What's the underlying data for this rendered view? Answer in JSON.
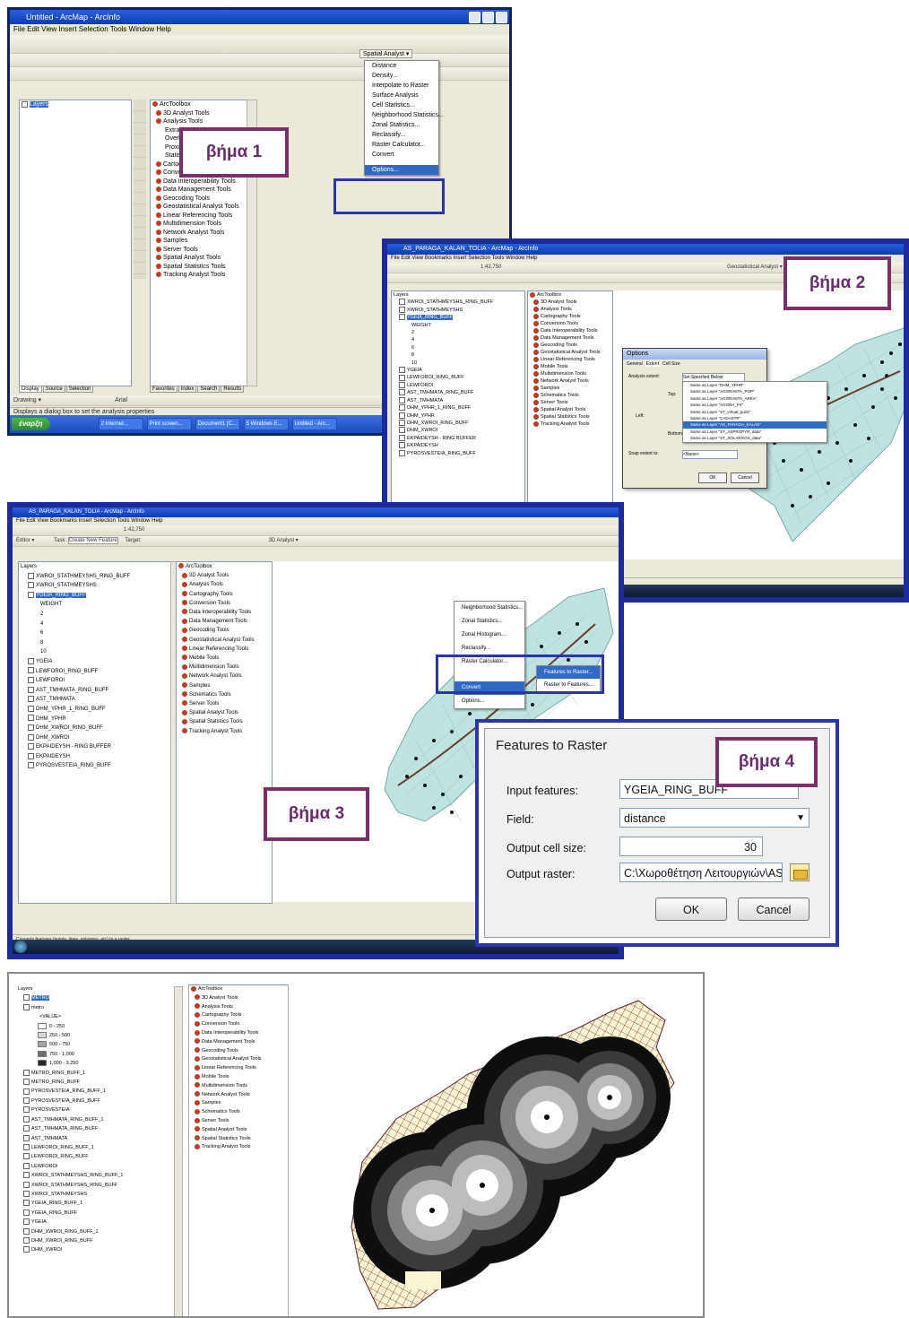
{
  "steps": {
    "s1": "βήμα 1",
    "s2": "βήμα 2",
    "s3": "βήμα 3",
    "s4": "βήμα 4"
  },
  "shot1": {
    "title": "Untitled - ArcMap - ArcInfo",
    "menu": "File  Edit  View  Insert  Selection  Tools  Window  Help",
    "layers_root": "Layers",
    "toolbox_root": "ArcToolbox",
    "toolbox": [
      "3D Analyst Tools",
      "Analysis Tools",
      "Extract",
      "Overlay",
      "Proximity",
      "Statistics",
      "Cartography Tools",
      "Conversion Tools",
      "Data Interoperability Tools",
      "Data Management Tools",
      "Geocoding Tools",
      "Geostatistical Analyst Tools",
      "Linear Referencing Tools",
      "Multidimension Tools",
      "Network Analyst Tools",
      "Samples",
      "Server Tools",
      "Spatial Analyst Tools",
      "Spatial Statistics Tools",
      "Tracking Analyst Tools"
    ],
    "spatial_analyst_menu": {
      "button": "Spatial Analyst ▾",
      "items": [
        "Distance",
        "Density...",
        "Interpolate to Raster",
        "Surface Analysis",
        "Cell Statistics...",
        "Neighborhood Statistics...",
        "Zonal Statistics...",
        "Reclassify...",
        "Raster Calculator...",
        "Convert",
        "Options..."
      ],
      "highlighted": "Options..."
    },
    "tabs": [
      "Display",
      "Source",
      "Selection"
    ],
    "toolbox_tabs": [
      "Favorites",
      "Index",
      "Search",
      "Results"
    ],
    "drawing": "Drawing ▾",
    "font": "Arial",
    "status": "Displays a dialog box to set the analysis properties",
    "start": "έναρξη",
    "taskbar": [
      "2 Internet...",
      "Print screen...",
      "Document1 [C...",
      "5 Windows E...",
      "Untitled - Arc..."
    ]
  },
  "shot2": {
    "title": "AS_PARAGA_KALAN_TOLIA - ArcMap - ArcInfo",
    "menu": "File  Edit  View  Bookmarks  Insert  Selection  Tools  Window  Help",
    "scale": "1:42,750",
    "geostat": "Geostatistical Analyst ▾",
    "layers_root": "Layers",
    "layers": [
      "XWROI_STATHMEYSHS_RING_BUFF",
      "XWROI_STATHMEYSHS",
      "YGEIA_RING_BUFF",
      "WEIGHT",
      "2",
      "4",
      "6",
      "8",
      "10",
      "YGEIA",
      "LEWFOROI_RING_BUFF",
      "LEWFOROI",
      "AST_TMHMATA_RING_BUFF",
      "AST_TMHMATA",
      "DHM_YPHR_1_RING_BUFF",
      "DHM_YPHR",
      "DHM_XWROI_RING_BUFF",
      "DHM_XWROI",
      "EKPAIDEYSH - RING BUFFER",
      "EKPAIDEYSH",
      "PYROSVESTEIA_RING_BUFF"
    ],
    "toolbox_root": "ArcToolbox",
    "toolbox": [
      "3D Analyst Tools",
      "Analysis Tools",
      "Cartography Tools",
      "Conversion Tools",
      "Data Interoperability Tools",
      "Data Management Tools",
      "Geocoding Tools",
      "Geostatistical Analyst Tools",
      "Linear Referencing Tools",
      "Mobile Tools",
      "Multidimension Tools",
      "Network Analyst Tools",
      "Samples",
      "Schematics Tools",
      "Server Tools",
      "Spatial Analyst Tools",
      "Spatial Statistics Tools",
      "Tracking Analyst Tools"
    ],
    "options_dialog": {
      "title": "Options",
      "tabs": [
        "General",
        "Extent",
        "Cell Size"
      ],
      "labels": [
        "Analysis extent:",
        "Top:",
        "Left:",
        "Bottom:",
        "Snap extent to:"
      ],
      "selected": "Set Specified Below",
      "list": [
        "Same as Layer \"DHM_YPHR\"",
        "Same as Layer \"AGORANTA_POP\"",
        "Same as Layer \"AGORANTA_AREA\"",
        "Same as Layer \"AGORA_P4\"",
        "Same as Layer \"ST_virtual_point\"",
        "Same as Layer \"CADASTR\"",
        "Same as Layer \"AS_PARAGA_KALAN\"",
        "Same as Layer \"ST_ASPROPYR_data\"",
        "Same as Layer \"ST_SOLARGOS_data\""
      ],
      "snap": "<None>",
      "ok": "OK",
      "cancel": "Cancel"
    },
    "status": "Displays a dialog box to set the analysis properties"
  },
  "shot3": {
    "title": "AS_PARAGA_KALAN_TOLIA - ArcMap - ArcInfo",
    "menu": "File  Edit  View  Bookmarks  Insert  Selection  Tools  Window  Help",
    "scale": "1:42,750",
    "editor": "Editor ▾",
    "create_feature": "Create New Feature",
    "task_label": "Task:",
    "target_label": "Target:",
    "spatial_analyst": "3D Analyst ▾",
    "layers_root": "Layers",
    "layers": [
      "XWROI_STATHMEYSHS_RING_BUFF",
      "XWROI_STATHMEYSHS",
      "YGEIA_RING_BUFF",
      "WEIGHT",
      "2",
      "4",
      "6",
      "8",
      "10",
      "YGEIA",
      "LEWFOROI_RING_BUFF",
      "LEWFOROI",
      "AST_TMHMATA_RING_BUFF",
      "AST_TMHMATA",
      "DHM_YPHR_1_RING_BUFF",
      "DHM_YPHR",
      "DHM_XWROI_RING_BUFF",
      "DHM_XWROI",
      "EKPAIDEYSH - RING BUFFER",
      "EKPAIDEYSH",
      "PYROSVESTEIA_RING_BUFF"
    ],
    "toolbox_root": "ArcToolbox",
    "toolbox": [
      "3D Analyst Tools",
      "Analysis Tools",
      "Cartography Tools",
      "Conversion Tools",
      "Data Interoperability Tools",
      "Data Management Tools",
      "Geocoding Tools",
      "Geostatistical Analyst Tools",
      "Linear Referencing Tools",
      "Mobile Tools",
      "Multidimension Tools",
      "Network Analyst Tools",
      "Samples",
      "Schematics Tools",
      "Server Tools",
      "Spatial Analyst Tools",
      "Spatial Statistics Tools",
      "Tracking Analyst Tools"
    ],
    "menu_items": [
      "Neighborhood Statistics...",
      "Zonal Statistics...",
      "Zonal Histogram...",
      "Reclassify...",
      "Raster Calculator..."
    ],
    "convert": "Convert",
    "options": "Options...",
    "submenu": [
      "Features to Raster...",
      "Raster to Features..."
    ],
    "status": "Converts features (points, lines, polygons, etc) to a raster"
  },
  "dialog4": {
    "title": "Features to Raster",
    "input_label": "Input features:",
    "input_value": "YGEIA_RING_BUFF",
    "field_label": "Field:",
    "field_value": "distance",
    "cell_label": "Output cell size:",
    "cell_value": "30",
    "raster_label": "Output raster:",
    "raster_value": "C:\\Χωροθέτηση Λειτουργιών\\AS",
    "ok": "OK",
    "cancel": "Cancel"
  },
  "shot5": {
    "layers_root": "Layers",
    "layers": [
      "METRO",
      "metro",
      "<VALUE>",
      "0 - 250",
      "250 - 500",
      "500 - 750",
      "750 - 1,000",
      "1,000 - 3,250",
      "METRO_RING_BUFF_1",
      "METRO_RING_BUFF",
      "PYROSVESTEIA_RING_BUFF_1",
      "PYROSVESTEIA_RING_BUFF",
      "PYROSVESTEIA",
      "AST_TMHMATA_RING_BUFF_1",
      "AST_TMHMATA_RING_BUFF",
      "AST_TMHMATA",
      "LEWFOROI_RING_BUFF_1",
      "LEWFOROI_RING_BUFF",
      "LEWFOROI",
      "XWROI_STATHMEYSHS_RING_BUFF_1",
      "XWROI_STATHMEYSHS_RING_BUFF",
      "XWROI_STATHMEYSHS",
      "YGEIA_RING_BUFF_1",
      "YGEIA_RING_BUFF",
      "YGEIA",
      "DHM_XWROI_RING_BUFF_1",
      "DHM_XWROI_RING_BUFF",
      "DHM_XWROI"
    ],
    "legend_colors": [
      "#ffffff",
      "#d9d9d9",
      "#a6a6a6",
      "#6e6e6e",
      "#262626"
    ],
    "toolbox_root": "ArcToolbox",
    "toolbox": [
      "3D Analyst Tools",
      "Analysis Tools",
      "Cartography Tools",
      "Conversion Tools",
      "Data Interoperability Tools",
      "Data Management Tools",
      "Geocoding Tools",
      "Geostatistical Analyst Tools",
      "Linear Referencing Tools",
      "Mobile Tools",
      "Multidimension Tools",
      "Network Analyst Tools",
      "Samples",
      "Schematics Tools",
      "Server Tools",
      "Spatial Analyst Tools",
      "Spatial Statistics Tools",
      "Tracking Analyst Tools"
    ]
  },
  "colors": {
    "step_border": "#7a2e6c",
    "highlight": "#2a35a8",
    "map_fill": "#bfe3e0",
    "raster_base": "#fbf6d2"
  }
}
